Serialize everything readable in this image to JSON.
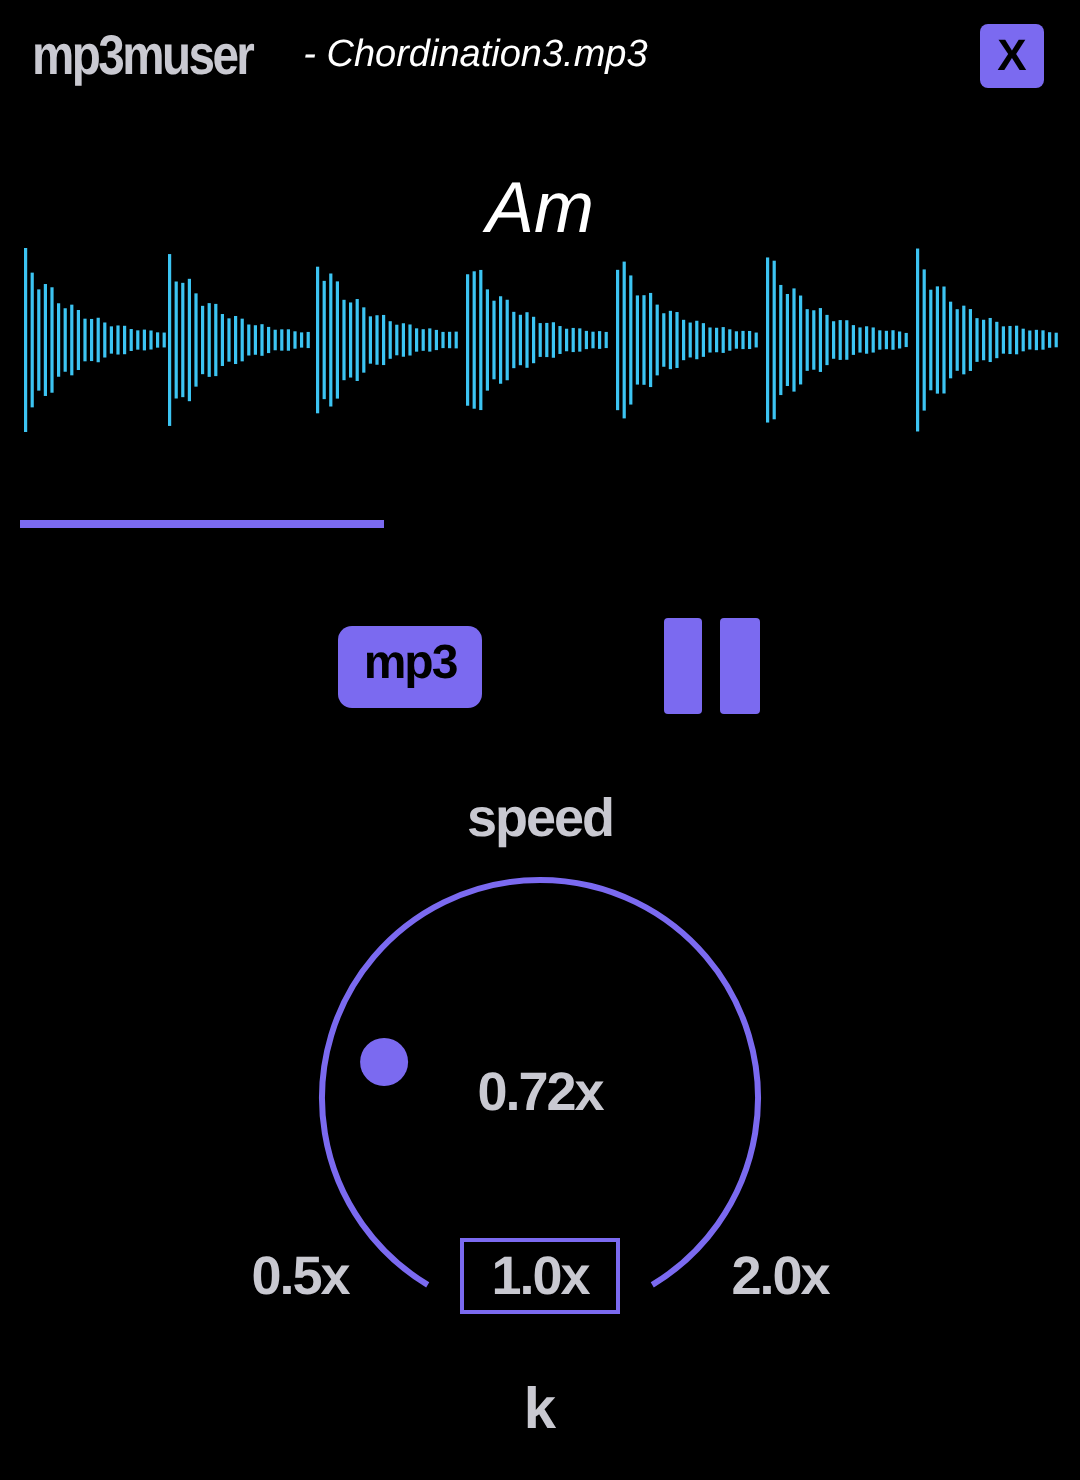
{
  "header": {
    "app_name": "mp3muser",
    "file_name": "- Chordination3.mp3",
    "close_label": "X"
  },
  "chord": "Am",
  "controls": {
    "format_label": "mp3",
    "playing": true
  },
  "speed": {
    "label": "speed",
    "value": "0.72x",
    "presets": [
      {
        "label": "0.5x",
        "selected": false
      },
      {
        "label": "1.0x",
        "selected": true
      },
      {
        "label": "2.0x",
        "selected": false
      }
    ]
  },
  "key_label": "k"
}
